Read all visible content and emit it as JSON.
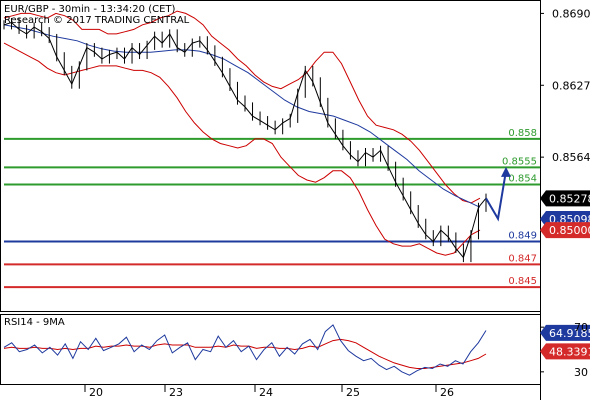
{
  "header": {
    "title": "EUR/GBP - 30min - 13:34:20 (CET)",
    "subtitle": "Research © 2017 TRADING CENTRAL"
  },
  "chart_data": [
    {
      "type": "line",
      "title": "EUR/GBP - 30min - 13:34:20 (CET)",
      "subtitle": "Research © 2017 TRADING CENTRAL",
      "xlabel": "",
      "ylabel": "",
      "x_tick_labels": [
        "20",
        "23",
        "24",
        "25",
        "26"
      ],
      "y_tick_labels": [
        "0.8690",
        "0.8627",
        "0.8564"
      ],
      "ylim": [
        0.843,
        0.87
      ],
      "grid": false,
      "price_series": [
        0.868,
        0.8682,
        0.8676,
        0.8672,
        0.8678,
        0.8674,
        0.8668,
        0.8652,
        0.864,
        0.8628,
        0.8644,
        0.866,
        0.8656,
        0.865,
        0.8654,
        0.8656,
        0.865,
        0.866,
        0.8654,
        0.8662,
        0.867,
        0.8664,
        0.8672,
        0.866,
        0.8656,
        0.8664,
        0.8666,
        0.8658,
        0.8648,
        0.8638,
        0.8626,
        0.8614,
        0.8608,
        0.86,
        0.8596,
        0.8592,
        0.8588,
        0.8594,
        0.8598,
        0.862,
        0.864,
        0.863,
        0.8612,
        0.8594,
        0.8584,
        0.8574,
        0.8566,
        0.856,
        0.8568,
        0.8564,
        0.857,
        0.8556,
        0.8542,
        0.853,
        0.8518,
        0.8506,
        0.8496,
        0.849,
        0.85,
        0.8494,
        0.8484,
        0.8476,
        0.8496,
        0.852,
        0.8528
      ],
      "bollinger_upper": [
        0.8686,
        0.8688,
        0.869,
        0.869,
        0.8688,
        0.8686,
        0.869,
        0.8688,
        0.8684,
        0.8676,
        0.8676,
        0.8676,
        0.8672,
        0.8672,
        0.8674,
        0.8676,
        0.868,
        0.8682,
        0.8686,
        0.8688,
        0.8692,
        0.869,
        0.8686,
        0.868,
        0.867,
        0.8664,
        0.8658,
        0.865,
        0.8644,
        0.8636,
        0.863,
        0.8626,
        0.8624,
        0.8628,
        0.8632,
        0.8638,
        0.8648,
        0.8656,
        0.8656,
        0.8646,
        0.863,
        0.8614,
        0.86,
        0.8592,
        0.859,
        0.8588,
        0.8584,
        0.8578,
        0.857,
        0.856,
        0.855,
        0.854,
        0.8532,
        0.8526,
        0.8524,
        0.8528
      ],
      "bollinger_lower": [
        0.8664,
        0.866,
        0.8656,
        0.8652,
        0.8648,
        0.8642,
        0.8638,
        0.8636,
        0.8638,
        0.864,
        0.8642,
        0.8644,
        0.8644,
        0.8644,
        0.8642,
        0.864,
        0.864,
        0.8638,
        0.8634,
        0.8626,
        0.8616,
        0.8604,
        0.8594,
        0.8586,
        0.858,
        0.8576,
        0.8574,
        0.8572,
        0.8574,
        0.858,
        0.858,
        0.8576,
        0.8564,
        0.8556,
        0.8548,
        0.8544,
        0.8542,
        0.8546,
        0.8552,
        0.8552,
        0.8546,
        0.8534,
        0.8518,
        0.8504,
        0.8492,
        0.8488,
        0.8486,
        0.8486,
        0.8488,
        0.8484,
        0.848,
        0.8478,
        0.848,
        0.8488,
        0.8496,
        0.85
      ],
      "moving_average": [
        0.868,
        0.8678,
        0.8676,
        0.8673,
        0.867,
        0.8668,
        0.8666,
        0.8662,
        0.8659,
        0.8657,
        0.8656,
        0.8656,
        0.8656,
        0.8657,
        0.8658,
        0.8658,
        0.8657,
        0.8654,
        0.865,
        0.8644,
        0.8638,
        0.863,
        0.8622,
        0.8614,
        0.8608,
        0.8604,
        0.8602,
        0.86,
        0.8596,
        0.8592,
        0.8586,
        0.8578,
        0.857,
        0.8562,
        0.8552,
        0.8544,
        0.8536,
        0.853,
        0.8525,
        0.852
      ],
      "levels": [
        {
          "value": 0.858,
          "label": "0.858",
          "color": "#2e9b2e"
        },
        {
          "value": 0.8555,
          "label": "0.8555",
          "color": "#2e9b2e"
        },
        {
          "value": 0.854,
          "label": "0.854",
          "color": "#2e9b2e"
        },
        {
          "value": 0.849,
          "label": "0.849",
          "color": "#1f3a9e"
        },
        {
          "value": 0.847,
          "label": "0.847",
          "color": "#d42a2a"
        },
        {
          "value": 0.845,
          "label": "0.845",
          "color": "#d42a2a"
        }
      ],
      "projection": [
        0.8528,
        0.851,
        0.8552
      ],
      "value_tags": [
        {
          "value": 0.85278,
          "label": "0.85278",
          "bg": "#000000",
          "fg": "#ffffff"
        },
        {
          "value": 0.85098,
          "label": "0.85098",
          "bg": "#1f3a9e",
          "fg": "#ffffff"
        },
        {
          "value": 0.85,
          "label": "0.85000",
          "bg": "#d42a2a",
          "fg": "#ffffff"
        }
      ],
      "colors": {
        "price": "#000000",
        "bands": "#cc0000",
        "ma": "#1f3a9e",
        "projection": "#1f3a9e"
      }
    },
    {
      "type": "line",
      "title": "RSI14 - 9MA",
      "ylim": [
        20,
        80
      ],
      "y_tick_labels": [
        "70",
        "30"
      ],
      "rsi": [
        52,
        56,
        48,
        50,
        54,
        47,
        52,
        45,
        55,
        42,
        57,
        50,
        60,
        49,
        52,
        55,
        61,
        48,
        54,
        50,
        58,
        63,
        47,
        52,
        56,
        41,
        50,
        48,
        62,
        52,
        58,
        48,
        53,
        41,
        50,
        56,
        44,
        52,
        46,
        55,
        59,
        50,
        66,
        72,
        58,
        49,
        44,
        40,
        42,
        36,
        32,
        35,
        30,
        27,
        31,
        34,
        33,
        37,
        35,
        40,
        37,
        48,
        56,
        67
      ],
      "rsi_ma": [
        51,
        52,
        51,
        51,
        52,
        51,
        51,
        50,
        51,
        50,
        51,
        51,
        53,
        52,
        53,
        53,
        54,
        53,
        53,
        52,
        54,
        55,
        54,
        54,
        54,
        52,
        52,
        52,
        53,
        52,
        54,
        53,
        53,
        51,
        52,
        52,
        51,
        51,
        50,
        51,
        53,
        52,
        55,
        58,
        59,
        58,
        56,
        52,
        48,
        44,
        41,
        38,
        36,
        34,
        33,
        33,
        34,
        35,
        36,
        37,
        38,
        40,
        42,
        46
      ],
      "value_tags": [
        {
          "value": 64.9185,
          "label": "64.9185",
          "bg": "#1f3a9e",
          "fg": "#ffffff"
        },
        {
          "value": 48.3391,
          "label": "48.3391",
          "bg": "#d42a2a",
          "fg": "#ffffff"
        }
      ],
      "colors": {
        "rsi": "#1f3a9e",
        "ma": "#cc0000"
      }
    }
  ]
}
